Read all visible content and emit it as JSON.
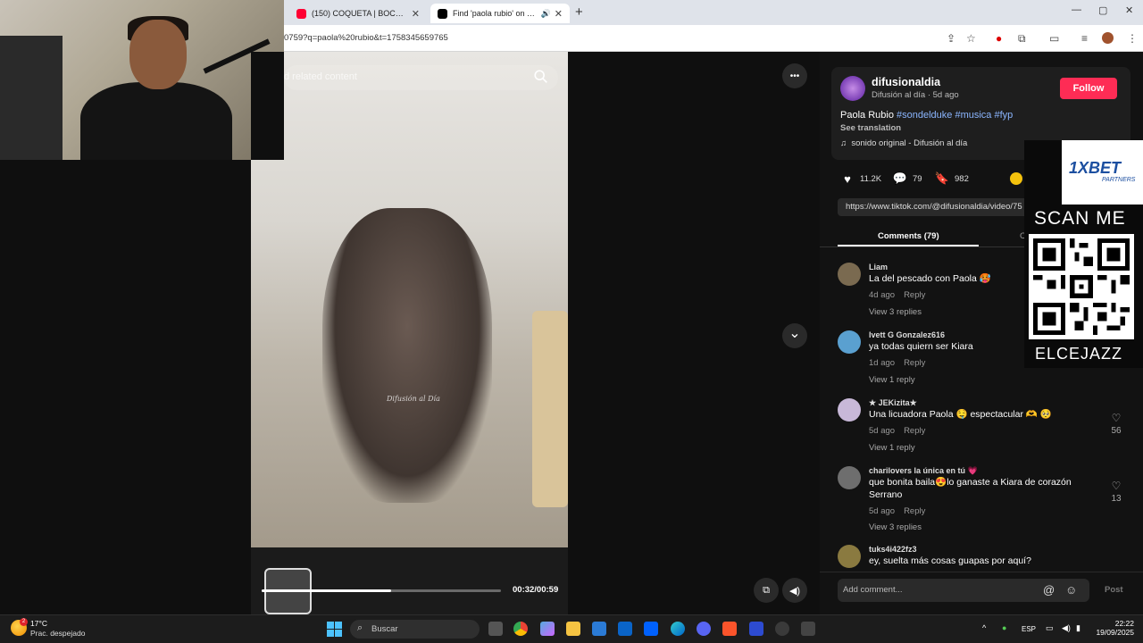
{
  "browser": {
    "tabs": [
      {
        "title": "(150) COQUETA | BOCCHI THE R",
        "active": false,
        "favicon_color": "#ff0033"
      },
      {
        "title": "Find 'paola rubio' on TikTok",
        "active": true,
        "favicon_color": "#000000"
      }
    ],
    "new_tab": "+",
    "url": "0759?q=paola%20rubio&t=1758345659765",
    "window_controls": [
      "—",
      "▢",
      "✕"
    ]
  },
  "video": {
    "search_placeholder": "d related content",
    "watermark": "Difusión al Día",
    "time": "00:32/00:59",
    "progress": 0.54
  },
  "post": {
    "author": "difusionaldia",
    "author_sub": "Difusión al día · 5d ago",
    "follow_label": "Follow",
    "caption_plain": "Paola Rubio ",
    "hashtags": [
      "#sondelduke",
      "#musica",
      "#fyp"
    ],
    "see_translation": "See translation",
    "music": "sonido original - Difusión al día",
    "likes": "11.2K",
    "comments_count": "79",
    "saves": "982",
    "link": "https://www.tiktok.com/@difusionaldia/video/75",
    "tab_comments": "Comments (79)",
    "tab_creator": "C"
  },
  "comments": [
    {
      "user": "Liam",
      "text": "La del pescado con Paola 🥵",
      "time": "4d ago",
      "reply": "Reply",
      "replies": "View 3 replies",
      "likes": "",
      "avatar_color": "#7a6a50"
    },
    {
      "user": "Ivett G Gonzalez616",
      "text": "ya todas quiern ser Kiara",
      "time": "1d ago",
      "reply": "Reply",
      "replies": "View 1 reply",
      "likes": "",
      "avatar_color": "#5aa0d0"
    },
    {
      "user": "★ JEKizita★",
      "text": "Una licuadora Paola 🤤 espectacular 🫶 🥺",
      "time": "5d ago",
      "reply": "Reply",
      "replies": "View 1 reply",
      "likes": "56",
      "avatar_color": "#c8b8d8"
    },
    {
      "user": "charilovers la única en tú 💗",
      "text": "que bonita baila😍lo ganaste a Kiara de corazón Serrano",
      "time": "5d ago",
      "reply": "Reply",
      "replies": "View 3 replies",
      "likes": "13",
      "avatar_color": "#6e6e6e"
    },
    {
      "user": "tuks4i422fz3",
      "text": "ey, suelta más cosas guapas por aquí?",
      "time": "",
      "reply": "",
      "replies": "",
      "likes": "",
      "avatar_color": "#8a7a40"
    }
  ],
  "comment_input": {
    "placeholder": "Add comment...",
    "post_label": "Post"
  },
  "ad": {
    "brand": "1XBET",
    "brand_sub": "PARTNERS",
    "scan": "SCAN ME",
    "code": "ELCEJAZZ"
  },
  "taskbar": {
    "temp": "17°C",
    "weather": "Prac. despejado",
    "weather_badge": "2",
    "search_placeholder": "Buscar",
    "lang": "ESP",
    "time": "22:22",
    "date": "19/09/2025"
  },
  "icons": {
    "more": "•••",
    "chevron_down": "⌄",
    "volume": "🔊",
    "heart": "♥",
    "comment": "●",
    "bookmark": "▮",
    "music": "♫"
  }
}
